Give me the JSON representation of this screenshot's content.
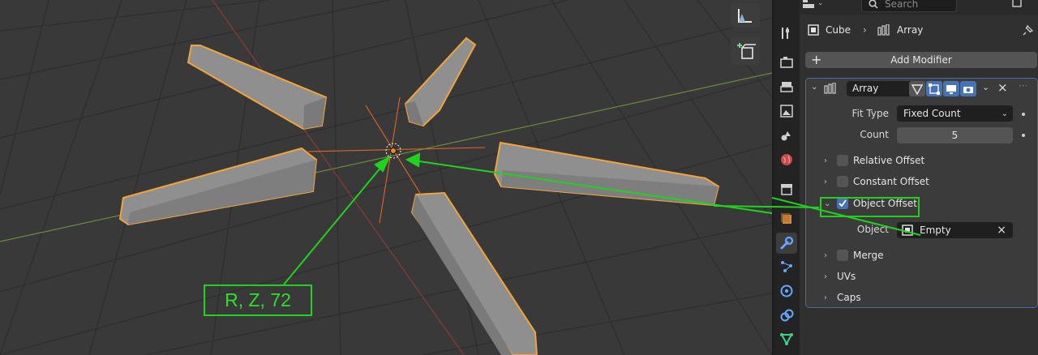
{
  "viewport": {
    "annotation_text": "R, Z, 72",
    "colors": {
      "accent_green": "#22d11e",
      "selection_orange": "#f2a33b"
    }
  },
  "header": {
    "search_placeholder": "Search"
  },
  "breadcrumb": {
    "object": "Cube",
    "modifier": "Array"
  },
  "add_modifier_label": "Add Modifier",
  "modifier": {
    "name": "Array",
    "fit_type_label": "Fit Type",
    "fit_type_value": "Fixed Count",
    "count_label": "Count",
    "count_value": "5",
    "relative_offset": "Relative Offset",
    "constant_offset": "Constant Offset",
    "object_offset": "Object Offset",
    "object_label": "Object",
    "object_value": "Empty",
    "merge": "Merge",
    "uvs": "UVs",
    "caps": "Caps"
  },
  "icons": [
    "editor-type-icon",
    "search-icon",
    "pin-icon",
    "tool-icon",
    "render-icon",
    "output-icon",
    "view-layer-icon",
    "scene-icon",
    "world-icon",
    "collection-icon",
    "object-icon",
    "modifier-wrench-icon",
    "particles-icon",
    "physics-icon",
    "constraints-icon",
    "data-icon",
    "ruler-icon",
    "camera-view-icon"
  ]
}
